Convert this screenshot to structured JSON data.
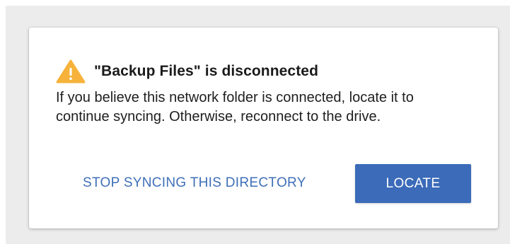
{
  "dialog": {
    "icon": "warning-icon",
    "title": "\"Backup Files\" is disconnected",
    "message": "If you believe this network folder is connected, locate it to continue syncing. Otherwise, reconnect to the drive.",
    "secondary_button_label": "STOP SYNCING THIS DIRECTORY",
    "primary_button_label": "LOCATE"
  },
  "colors": {
    "warning": "#f6b23a",
    "accent": "#3b6bb9",
    "link_text": "#3f6fb8",
    "backdrop": "#ececec"
  }
}
